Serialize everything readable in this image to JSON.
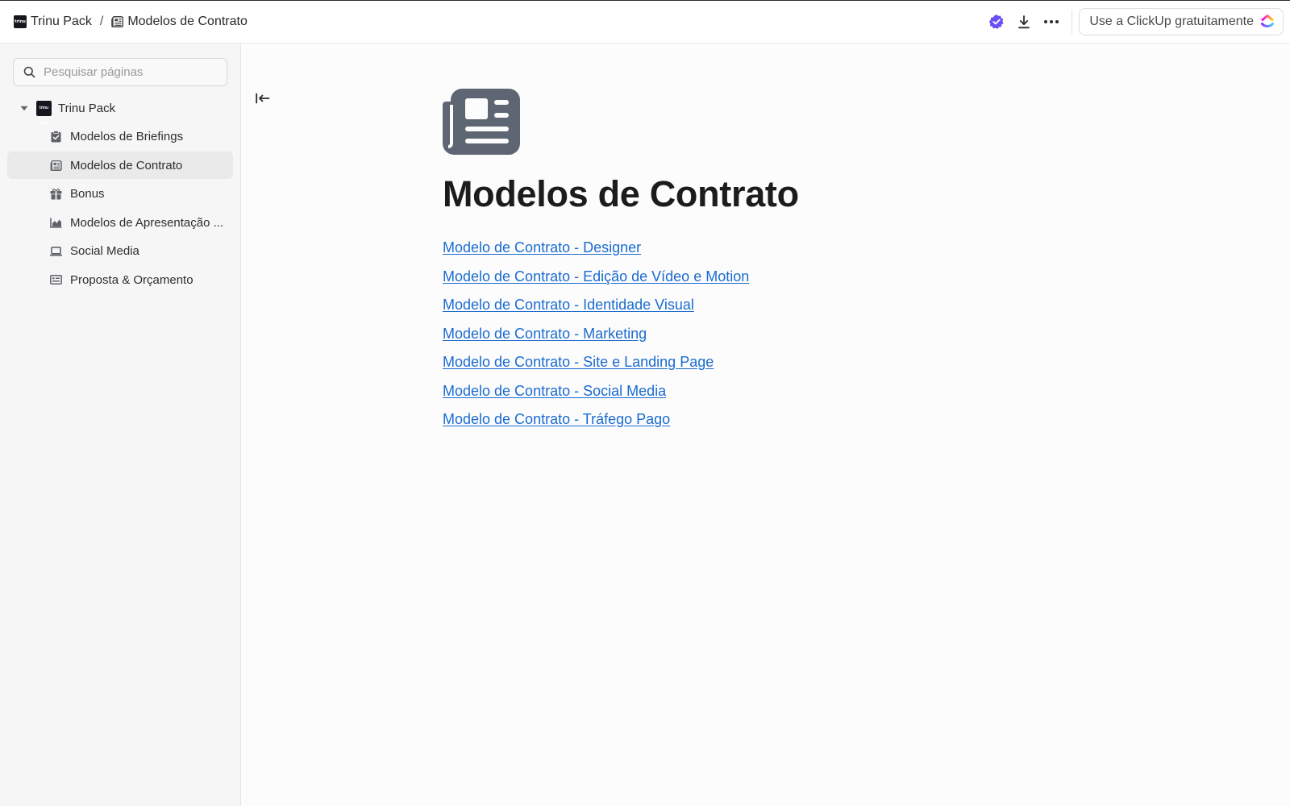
{
  "topbar": {
    "breadcrumb": [
      {
        "label": "Trinu Pack",
        "icon": "workspace-logo"
      },
      {
        "label": "Modelos de Contrato",
        "icon": "newspaper-icon"
      }
    ],
    "separator": "/",
    "logo_text": "trinu pack",
    "cta_label": "Use a ClickUp gratuitamente",
    "accent_color": "#6b4ff6"
  },
  "sidebar": {
    "search_placeholder": "Pesquisar páginas",
    "root": {
      "label": "Trinu Pack",
      "expanded": true
    },
    "items": [
      {
        "label": "Modelos de Briefings",
        "icon": "clipboard-check-icon",
        "active": false
      },
      {
        "label": "Modelos de Contrato",
        "icon": "newspaper-icon",
        "active": true
      },
      {
        "label": "Bonus",
        "icon": "gift-icon",
        "active": false
      },
      {
        "label": "Modelos de Apresentação ...",
        "icon": "chart-area-icon",
        "active": false
      },
      {
        "label": "Social Media",
        "icon": "laptop-icon",
        "active": false
      },
      {
        "label": "Proposta & Orçamento",
        "icon": "id-card-icon",
        "active": false
      }
    ]
  },
  "main": {
    "page_icon": "newspaper-icon",
    "title": "Modelos de Contrato",
    "links": [
      "Modelo de Contrato - Designer",
      "Modelo de Contrato - Edição de Vídeo e Motion",
      "Modelo de Contrato - Identidade Visual",
      "Modelo de Contrato - Marketing",
      "Modelo de Contrato - Site e Landing Page",
      "Modelo de Contrato - Social Media",
      "Modelo de Contrato - Tráfego Pago"
    ],
    "link_color": "#1a6bd1"
  }
}
